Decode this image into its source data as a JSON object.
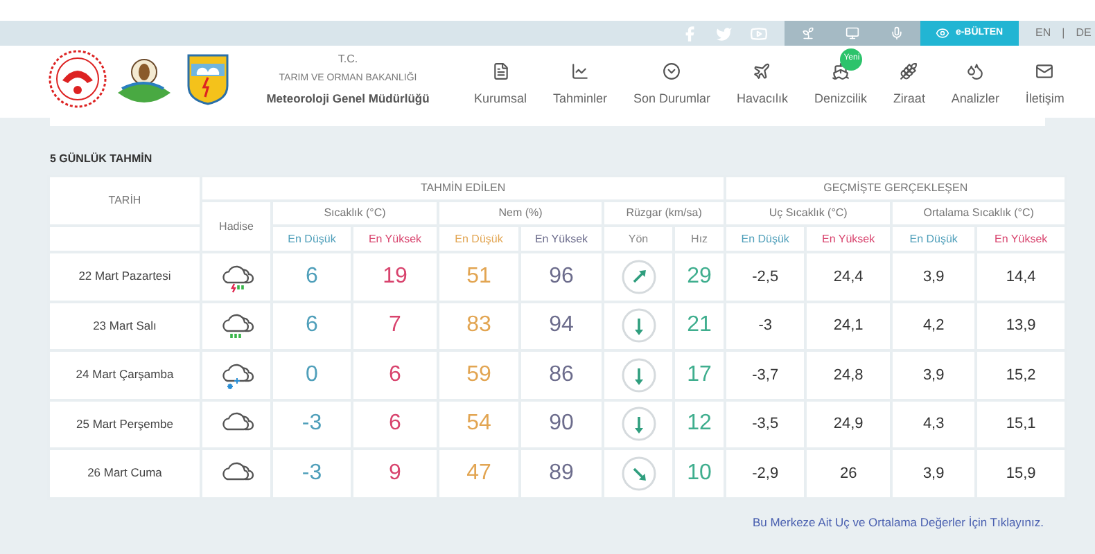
{
  "top_bar": {
    "lang": [
      {
        "label": "EN",
        "selected": false
      },
      {
        "label": "DE",
        "selected": false
      }
    ],
    "separator": "|",
    "bulletin": "e-BÜLTEN"
  },
  "header": {
    "org_lines": [
      "T.C.",
      "TARIM VE ORMAN BAKANLIĞI",
      "Meteoroloji Genel Müdürlüğü"
    ],
    "nav": [
      {
        "label": "Kurumsal",
        "kind": "doc"
      },
      {
        "label": "Tahminler",
        "kind": "chart"
      },
      {
        "label": "Son Durumlar",
        "kind": "circle"
      },
      {
        "label": "Havacılık",
        "kind": "plane"
      },
      {
        "label": "Denizcilik",
        "kind": "ship",
        "badge": "Yeni"
      },
      {
        "label": "Ziraat",
        "kind": "wheat"
      },
      {
        "label": "Analizler",
        "kind": "drop"
      },
      {
        "label": "İletişim",
        "kind": "mail"
      }
    ]
  },
  "forecast": {
    "title": "5 GÜNLÜK TAHMİN",
    "groups": [
      "TAHMİN EDİLEN",
      "GEÇMİŞTE GERÇEKLEŞEN"
    ],
    "date_header": "TARİH",
    "event_header": "Hadise",
    "subgroups": [
      "Sıcaklık (°C)",
      "Nem (%)",
      "Rüzgar (km/sa)",
      "Uç Sıcaklık (°C)",
      "Ortalama Sıcaklık (°C)"
    ],
    "columns": [
      "En Düşük",
      "En Yüksek",
      "En Düşük",
      "En Yüksek",
      "Yön",
      "Hız",
      "En Düşük",
      "En Yüksek",
      "En Düşük",
      "En Yüksek"
    ],
    "rows": [
      {
        "date": "22 Mart Pazartesi",
        "event": {
          "kind": "storm"
        },
        "temp_low": "6",
        "temp_high": "19",
        "hum_low": "51",
        "hum_high": "96",
        "wind": {
          "kind": "ne",
          "speed": "29"
        },
        "ext_low": "-2,5",
        "ext_high": "24,4",
        "avg_low": "3,9",
        "avg_high": "14,4"
      },
      {
        "date": "23 Mart Salı",
        "event": {
          "kind": "rain"
        },
        "temp_low": "6",
        "temp_high": "7",
        "hum_low": "83",
        "hum_high": "94",
        "wind": {
          "kind": "s",
          "speed": "21"
        },
        "ext_low": "-3",
        "ext_high": "24,1",
        "avg_low": "4,2",
        "avg_high": "13,9"
      },
      {
        "date": "24 Mart Çarşamba",
        "event": {
          "kind": "snow"
        },
        "temp_low": "0",
        "temp_high": "6",
        "hum_low": "59",
        "hum_high": "86",
        "wind": {
          "kind": "s",
          "speed": "17"
        },
        "ext_low": "-3,7",
        "ext_high": "24,8",
        "avg_low": "3,9",
        "avg_high": "15,2"
      },
      {
        "date": "25 Mart Perşembe",
        "event": {
          "kind": "cloudy"
        },
        "temp_low": "-3",
        "temp_high": "6",
        "hum_low": "54",
        "hum_high": "90",
        "wind": {
          "kind": "s",
          "speed": "12"
        },
        "ext_low": "-3,5",
        "ext_high": "24,9",
        "avg_low": "4,3",
        "avg_high": "15,1"
      },
      {
        "date": "26 Mart Cuma",
        "event": {
          "kind": "cloudy"
        },
        "temp_low": "-3",
        "temp_high": "9",
        "hum_low": "47",
        "hum_high": "89",
        "wind": {
          "kind": "se",
          "speed": "10"
        },
        "ext_low": "-2,9",
        "ext_high": "26",
        "avg_low": "3,9",
        "avg_high": "15,9"
      }
    ],
    "link": "Bu Merkeze Ait Uç ve Ortalama Değerler İçin Tıklayınız."
  }
}
